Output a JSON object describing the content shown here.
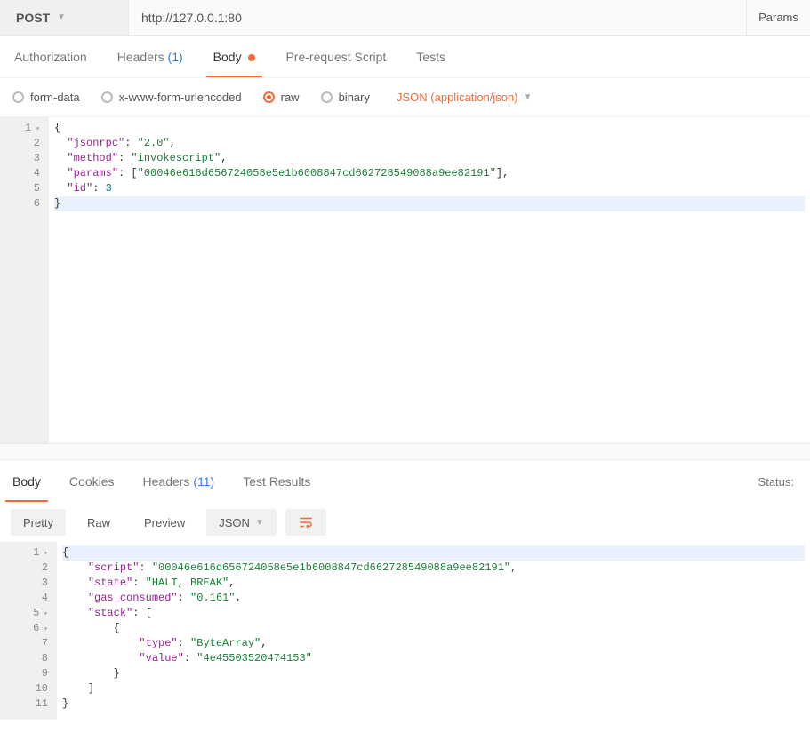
{
  "topbar": {
    "method": "POST",
    "url": "http://127.0.0.1:80",
    "params_button": "Params"
  },
  "request_tabs": {
    "authorization": "Authorization",
    "headers_label": "Headers ",
    "headers_count": "(1)",
    "body": "Body",
    "prerequest": "Pre-request Script",
    "tests": "Tests"
  },
  "body_types": {
    "form_data": "form-data",
    "urlencoded": "x-www-form-urlencoded",
    "raw": "raw",
    "binary": "binary",
    "content_type": "JSON (application/json)"
  },
  "request_body": {
    "jsonrpc": "2.0",
    "method": "invokescript",
    "params": [
      "00046e616d656724058e5e1b6008847cd662728549088a9ee82191"
    ],
    "id": 3
  },
  "response_tabs": {
    "body": "Body",
    "cookies": "Cookies",
    "headers_label": "Headers ",
    "headers_count": "(11)",
    "test_results": "Test Results",
    "status_label": "Status:"
  },
  "toolbar": {
    "pretty": "Pretty",
    "raw": "Raw",
    "preview": "Preview",
    "format": "JSON"
  },
  "response_body": {
    "script": "00046e616d656724058e5e1b6008847cd662728549088a9ee82191",
    "state": "HALT, BREAK",
    "gas_consumed": "0.161",
    "stack": [
      {
        "type": "ByteArray",
        "value": "4e45503520474153"
      }
    ]
  }
}
